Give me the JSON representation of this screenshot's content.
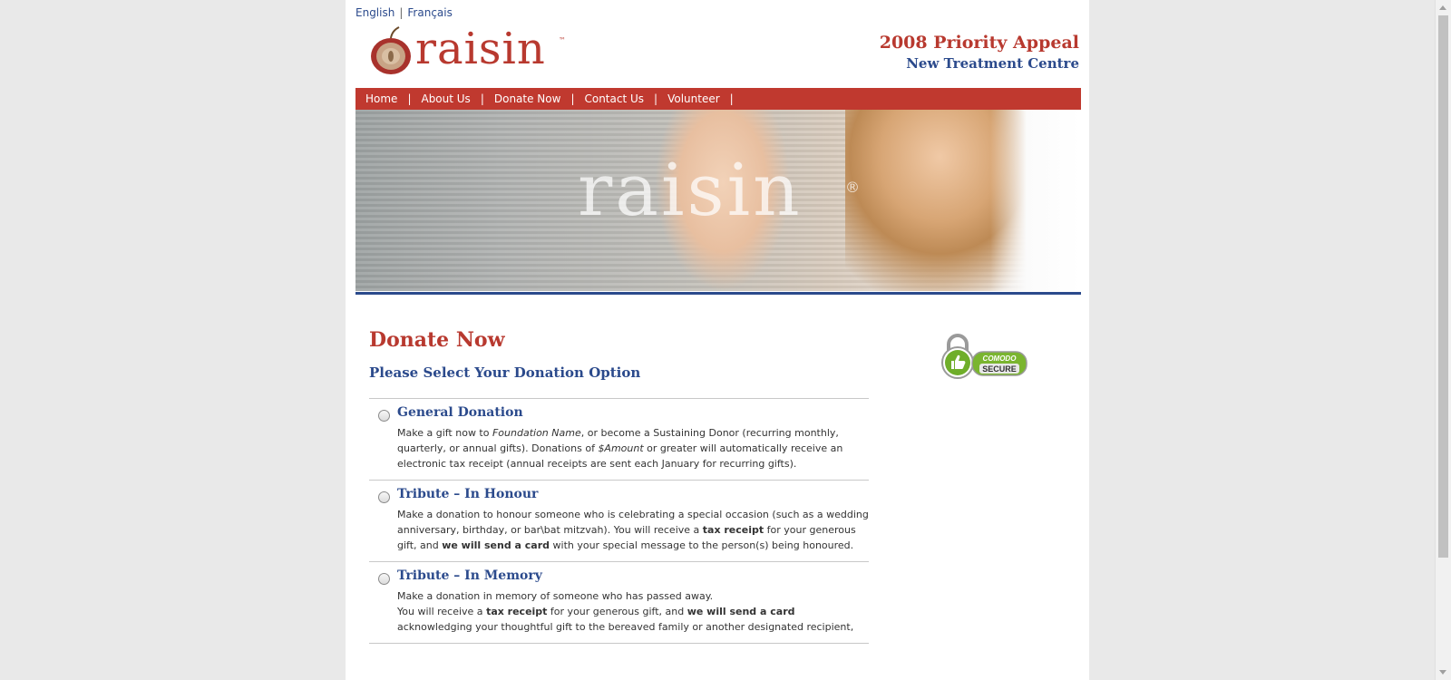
{
  "lang": {
    "english": "English",
    "sep": "|",
    "french": "Français"
  },
  "logo": {
    "word": "raisin",
    "tm": "™",
    "icon": "grape-icon"
  },
  "appeal": {
    "title": "2008 Priority Appeal",
    "subtitle": "New Treatment Centre"
  },
  "nav": {
    "items": [
      "Home",
      "About Us",
      "Donate Now",
      "Contact Us",
      "Volunteer"
    ],
    "sep": "|"
  },
  "hero": {
    "watermark": "raisin",
    "registered": "®"
  },
  "main": {
    "heading": "Donate Now",
    "subheading": "Please Select Your Donation Option"
  },
  "badge": {
    "icon": "comodo-secure-badge",
    "line1": "COMODO",
    "line2": "SECURE"
  },
  "options": [
    {
      "title": "General Donation",
      "text_a": "Make a gift now to ",
      "italic_a": "Foundation Name",
      "text_b": ", or become a Sustaining Donor (recurring monthly, quarterly, or annual gifts). Donations of ",
      "italic_b": "$Amount",
      "text_c": " or greater will automatically receive an electronic tax receipt (annual receipts are sent each January for recurring gifts)."
    },
    {
      "title": "Tribute – In Honour",
      "text_a": "Make a donation to honour someone who is celebrating a special occasion (such as a wedding anniversary, birthday, or bar\\bat mitzvah). You will receive a ",
      "bold_a": "tax receipt",
      "text_b": " for your generous gift, and ",
      "bold_b": "we will send a card",
      "text_c": " with your special message to the person(s) being honoured."
    },
    {
      "title": "Tribute – In Memory",
      "line1": "Make a donation in memory of someone who has passed away.",
      "text_a": "You will receive a ",
      "bold_a": "tax receipt",
      "text_b": " for your generous gift, and ",
      "bold_b": "we will send a card",
      "text_c": " acknowledging your thoughtful gift to the bereaved family or another designated recipient,"
    }
  ],
  "colors": {
    "brand_red": "#c0392f",
    "brand_blue": "#2b4a8c",
    "badge_green": "#7ab52f"
  }
}
